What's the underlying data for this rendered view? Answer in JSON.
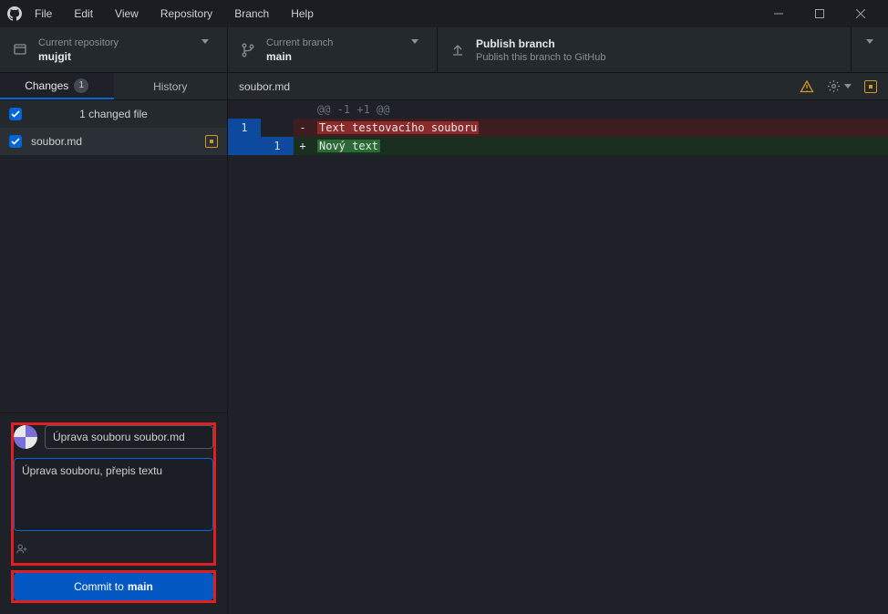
{
  "menu": [
    "File",
    "Edit",
    "View",
    "Repository",
    "Branch",
    "Help"
  ],
  "header": {
    "repo_label": "Current repository",
    "repo_name": "mujgit",
    "branch_label": "Current branch",
    "branch_name": "main",
    "publish_title": "Publish branch",
    "publish_desc": "Publish this branch to GitHub"
  },
  "tabs": {
    "changes": "Changes",
    "changes_count": "1",
    "history": "History"
  },
  "files": {
    "header": "1 changed file",
    "items": [
      {
        "name": "soubor.md"
      }
    ]
  },
  "commit": {
    "summary": "Úprava souboru soubor.md",
    "description": "Úprava souboru, přepis textu",
    "button_prefix": "Commit to ",
    "button_branch": "main"
  },
  "diff": {
    "filename": "soubor.md",
    "hunk": "@@ -1 +1 @@",
    "lines": [
      {
        "type": "del",
        "old": "1",
        "new": "",
        "text": "Text testovacího souboru"
      },
      {
        "type": "add",
        "old": "",
        "new": "1",
        "text": "Nový text"
      }
    ]
  }
}
